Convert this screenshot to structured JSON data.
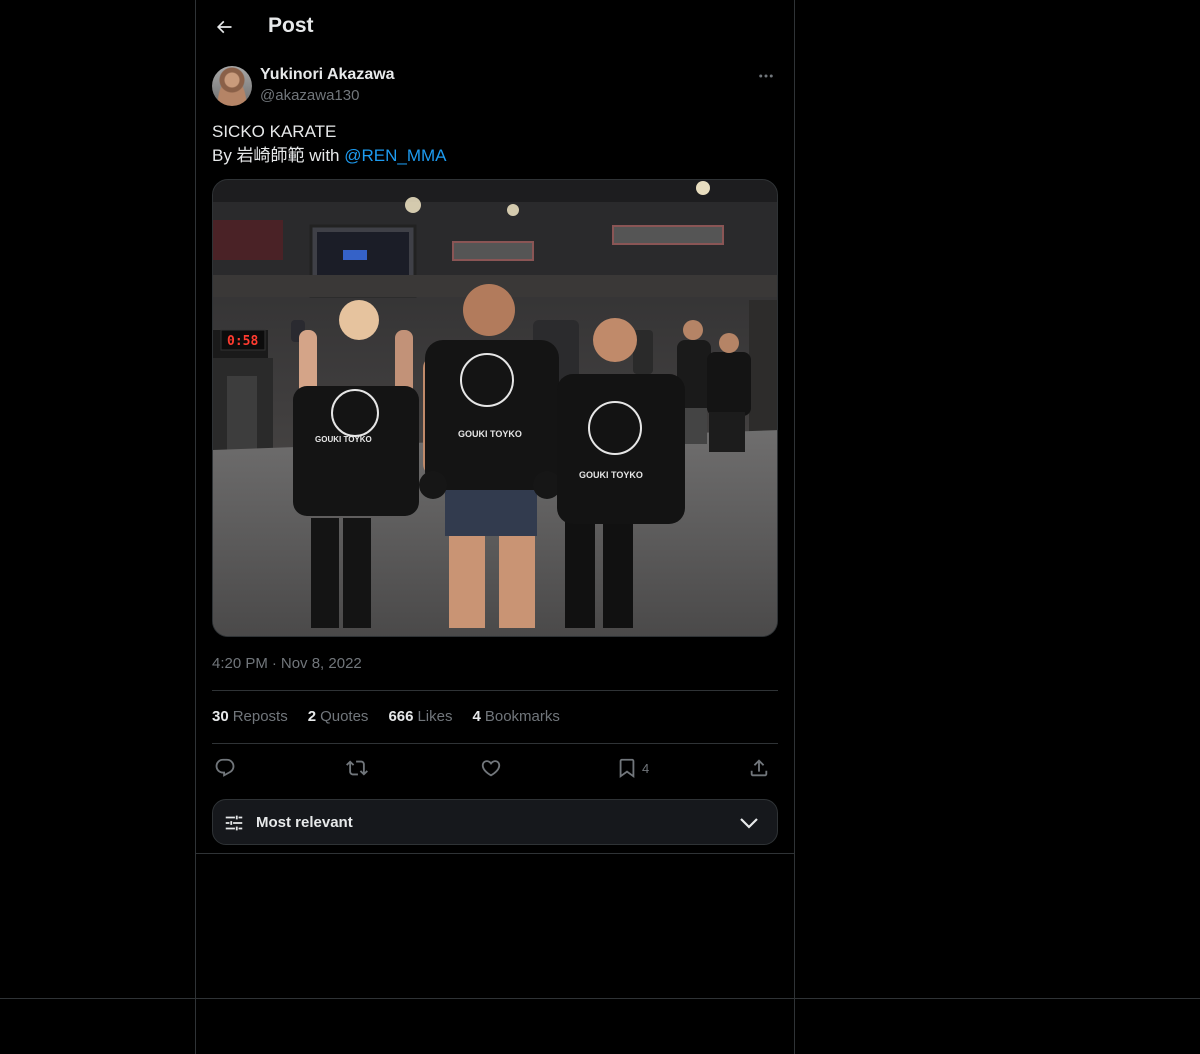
{
  "header": {
    "title": "Post"
  },
  "author": {
    "display_name": "Yukinori Akazawa",
    "handle": "@akazawa130"
  },
  "tweet": {
    "line1": "SICKO KARATE",
    "line2_prefix": "By 岩崎師範 with ",
    "mention": "@REN_MMA",
    "media_shirt_text": "GOUKI TOYKO",
    "media_clock": "0:58"
  },
  "meta": {
    "time": "4:20 PM",
    "separator": "·",
    "date": "Nov 8, 2022"
  },
  "stats": {
    "reposts_count": "30",
    "reposts_label": "Reposts",
    "quotes_count": "2",
    "quotes_label": "Quotes",
    "likes_count": "666",
    "likes_label": "Likes",
    "bookmarks_count": "4",
    "bookmarks_label": "Bookmarks"
  },
  "actions": {
    "bookmark_count": "4"
  },
  "sort": {
    "label": "Most relevant"
  },
  "colors": {
    "background": "#000000",
    "text": "#e7e9ea",
    "muted": "#71767b",
    "accent": "#1d9bf0",
    "border": "#2f3336"
  }
}
